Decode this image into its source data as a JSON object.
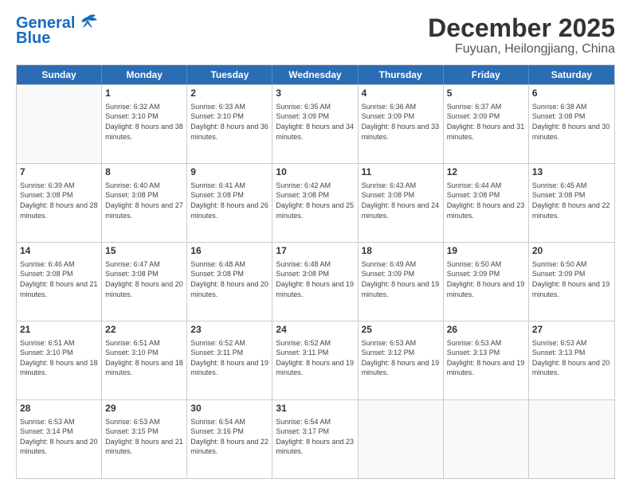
{
  "header": {
    "logo_line1": "General",
    "logo_line2": "Blue",
    "month_year": "December 2025",
    "location": "Fuyuan, Heilongjiang, China"
  },
  "days_of_week": [
    "Sunday",
    "Monday",
    "Tuesday",
    "Wednesday",
    "Thursday",
    "Friday",
    "Saturday"
  ],
  "weeks": [
    [
      {
        "day": "",
        "sunrise": "",
        "sunset": "",
        "daylight": ""
      },
      {
        "day": "1",
        "sunrise": "Sunrise: 6:32 AM",
        "sunset": "Sunset: 3:10 PM",
        "daylight": "Daylight: 8 hours and 38 minutes."
      },
      {
        "day": "2",
        "sunrise": "Sunrise: 6:33 AM",
        "sunset": "Sunset: 3:10 PM",
        "daylight": "Daylight: 8 hours and 36 minutes."
      },
      {
        "day": "3",
        "sunrise": "Sunrise: 6:35 AM",
        "sunset": "Sunset: 3:09 PM",
        "daylight": "Daylight: 8 hours and 34 minutes."
      },
      {
        "day": "4",
        "sunrise": "Sunrise: 6:36 AM",
        "sunset": "Sunset: 3:09 PM",
        "daylight": "Daylight: 8 hours and 33 minutes."
      },
      {
        "day": "5",
        "sunrise": "Sunrise: 6:37 AM",
        "sunset": "Sunset: 3:09 PM",
        "daylight": "Daylight: 8 hours and 31 minutes."
      },
      {
        "day": "6",
        "sunrise": "Sunrise: 6:38 AM",
        "sunset": "Sunset: 3:08 PM",
        "daylight": "Daylight: 8 hours and 30 minutes."
      }
    ],
    [
      {
        "day": "7",
        "sunrise": "Sunrise: 6:39 AM",
        "sunset": "Sunset: 3:08 PM",
        "daylight": "Daylight: 8 hours and 28 minutes."
      },
      {
        "day": "8",
        "sunrise": "Sunrise: 6:40 AM",
        "sunset": "Sunset: 3:08 PM",
        "daylight": "Daylight: 8 hours and 27 minutes."
      },
      {
        "day": "9",
        "sunrise": "Sunrise: 6:41 AM",
        "sunset": "Sunset: 3:08 PM",
        "daylight": "Daylight: 8 hours and 26 minutes."
      },
      {
        "day": "10",
        "sunrise": "Sunrise: 6:42 AM",
        "sunset": "Sunset: 3:08 PM",
        "daylight": "Daylight: 8 hours and 25 minutes."
      },
      {
        "day": "11",
        "sunrise": "Sunrise: 6:43 AM",
        "sunset": "Sunset: 3:08 PM",
        "daylight": "Daylight: 8 hours and 24 minutes."
      },
      {
        "day": "12",
        "sunrise": "Sunrise: 6:44 AM",
        "sunset": "Sunset: 3:08 PM",
        "daylight": "Daylight: 8 hours and 23 minutes."
      },
      {
        "day": "13",
        "sunrise": "Sunrise: 6:45 AM",
        "sunset": "Sunset: 3:08 PM",
        "daylight": "Daylight: 8 hours and 22 minutes."
      }
    ],
    [
      {
        "day": "14",
        "sunrise": "Sunrise: 6:46 AM",
        "sunset": "Sunset: 3:08 PM",
        "daylight": "Daylight: 8 hours and 21 minutes."
      },
      {
        "day": "15",
        "sunrise": "Sunrise: 6:47 AM",
        "sunset": "Sunset: 3:08 PM",
        "daylight": "Daylight: 8 hours and 20 minutes."
      },
      {
        "day": "16",
        "sunrise": "Sunrise: 6:48 AM",
        "sunset": "Sunset: 3:08 PM",
        "daylight": "Daylight: 8 hours and 20 minutes."
      },
      {
        "day": "17",
        "sunrise": "Sunrise: 6:48 AM",
        "sunset": "Sunset: 3:08 PM",
        "daylight": "Daylight: 8 hours and 19 minutes."
      },
      {
        "day": "18",
        "sunrise": "Sunrise: 6:49 AM",
        "sunset": "Sunset: 3:09 PM",
        "daylight": "Daylight: 8 hours and 19 minutes."
      },
      {
        "day": "19",
        "sunrise": "Sunrise: 6:50 AM",
        "sunset": "Sunset: 3:09 PM",
        "daylight": "Daylight: 8 hours and 19 minutes."
      },
      {
        "day": "20",
        "sunrise": "Sunrise: 6:50 AM",
        "sunset": "Sunset: 3:09 PM",
        "daylight": "Daylight: 8 hours and 19 minutes."
      }
    ],
    [
      {
        "day": "21",
        "sunrise": "Sunrise: 6:51 AM",
        "sunset": "Sunset: 3:10 PM",
        "daylight": "Daylight: 8 hours and 18 minutes."
      },
      {
        "day": "22",
        "sunrise": "Sunrise: 6:51 AM",
        "sunset": "Sunset: 3:10 PM",
        "daylight": "Daylight: 8 hours and 18 minutes."
      },
      {
        "day": "23",
        "sunrise": "Sunrise: 6:52 AM",
        "sunset": "Sunset: 3:11 PM",
        "daylight": "Daylight: 8 hours and 19 minutes."
      },
      {
        "day": "24",
        "sunrise": "Sunrise: 6:52 AM",
        "sunset": "Sunset: 3:11 PM",
        "daylight": "Daylight: 8 hours and 19 minutes."
      },
      {
        "day": "25",
        "sunrise": "Sunrise: 6:53 AM",
        "sunset": "Sunset: 3:12 PM",
        "daylight": "Daylight: 8 hours and 19 minutes."
      },
      {
        "day": "26",
        "sunrise": "Sunrise: 6:53 AM",
        "sunset": "Sunset: 3:13 PM",
        "daylight": "Daylight: 8 hours and 19 minutes."
      },
      {
        "day": "27",
        "sunrise": "Sunrise: 6:53 AM",
        "sunset": "Sunset: 3:13 PM",
        "daylight": "Daylight: 8 hours and 20 minutes."
      }
    ],
    [
      {
        "day": "28",
        "sunrise": "Sunrise: 6:53 AM",
        "sunset": "Sunset: 3:14 PM",
        "daylight": "Daylight: 8 hours and 20 minutes."
      },
      {
        "day": "29",
        "sunrise": "Sunrise: 6:53 AM",
        "sunset": "Sunset: 3:15 PM",
        "daylight": "Daylight: 8 hours and 21 minutes."
      },
      {
        "day": "30",
        "sunrise": "Sunrise: 6:54 AM",
        "sunset": "Sunset: 3:16 PM",
        "daylight": "Daylight: 8 hours and 22 minutes."
      },
      {
        "day": "31",
        "sunrise": "Sunrise: 6:54 AM",
        "sunset": "Sunset: 3:17 PM",
        "daylight": "Daylight: 8 hours and 23 minutes."
      },
      {
        "day": "",
        "sunrise": "",
        "sunset": "",
        "daylight": ""
      },
      {
        "day": "",
        "sunrise": "",
        "sunset": "",
        "daylight": ""
      },
      {
        "day": "",
        "sunrise": "",
        "sunset": "",
        "daylight": ""
      }
    ]
  ]
}
